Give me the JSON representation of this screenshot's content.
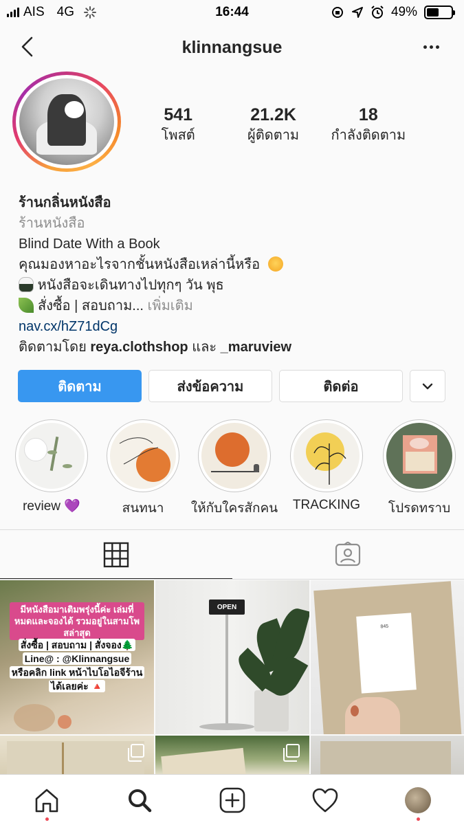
{
  "status_bar": {
    "carrier": "AIS",
    "network": "4G",
    "time": "16:44",
    "battery": "49%",
    "battery_level": 0.49
  },
  "header": {
    "username": "klinnangsue"
  },
  "profile": {
    "stats": [
      {
        "value": "541",
        "label": "โพสต์"
      },
      {
        "value": "21.2K",
        "label": "ผู้ติดตาม"
      },
      {
        "value": "18",
        "label": "กำลังติดตาม"
      }
    ],
    "name": "ร้านกลิ่นหนังสือ",
    "category": "ร้านหนังสือ",
    "bio_line1": "Blind Date With a Book",
    "bio_line2": "คุณมองหาอะไรจากชั้นหนังสือเหล่านี้หรือ",
    "bio_line3": "หนังสือจะเดินทางไปทุกๆ วัน พุธ",
    "bio_line4": "สั่งซื้อ | สอบถาม...",
    "more": "เพิ่มเติม",
    "link": "nav.cx/hZ71dCg",
    "followed_prefix": "ติดตามโดย",
    "followed_user1": "reya.clothshop",
    "followed_and": "และ",
    "followed_user2": "_maruview"
  },
  "actions": {
    "follow": "ติดตาม",
    "message": "ส่งข้อความ",
    "contact": "ติดต่อ"
  },
  "highlights": [
    {
      "label": "review 💜"
    },
    {
      "label": "สนทนา"
    },
    {
      "label": "ให้กับใครสักคน"
    },
    {
      "label": "TRACKING"
    },
    {
      "label": "โปรดทราบ"
    }
  ],
  "posts": {
    "post1_banner": "มีหนังสือมาเติมพรุ่งนี้ค่ะ เล่มที่หมดและจองได้ รวมอยู่ในสามโพสล่าสุด",
    "post1_line1": "สั่งซื้อ | สอบถาม | สั่งจอง🌲",
    "post1_line2": "Line@ : @Klinnangsue",
    "post1_line3": "หรือคลิก link หน้าไบโอไอจีร้าน",
    "post1_line4": "ได้เลยค่ะ 🔺",
    "post2_sign": "OPEN",
    "post3_card": "845"
  },
  "colors": {
    "follow_button": "#3897f0",
    "link": "#003569",
    "notification_dot": "#ed4956"
  }
}
